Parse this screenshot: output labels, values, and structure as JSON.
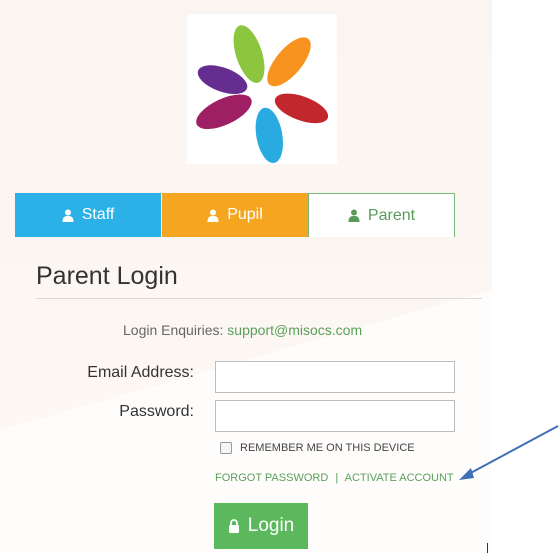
{
  "tabs": [
    {
      "label": "Staff",
      "icon": "user-icon",
      "color": "#2bb1e8"
    },
    {
      "label": "Pupil",
      "icon": "user-icon",
      "color": "#f6a521"
    },
    {
      "label": "Parent",
      "icon": "user-icon",
      "color": "#5a9a5a",
      "active": true
    }
  ],
  "heading": "Parent Login",
  "enquiries": {
    "label": "Login Enquiries:",
    "email": "support@misocs.com"
  },
  "form": {
    "email_label": "Email Address:",
    "password_label": "Password:",
    "email_value": "",
    "password_value": ""
  },
  "remember_label": "REMEMBER ME ON THIS DEVICE",
  "links": {
    "forgot": "FORGOT PASSWORD",
    "separator": "|",
    "activate": "ACTIVATE ACCOUNT"
  },
  "login_button": "Login",
  "colors": {
    "accent_green": "#5cb85c",
    "arrow_blue": "#3f6fb5"
  }
}
